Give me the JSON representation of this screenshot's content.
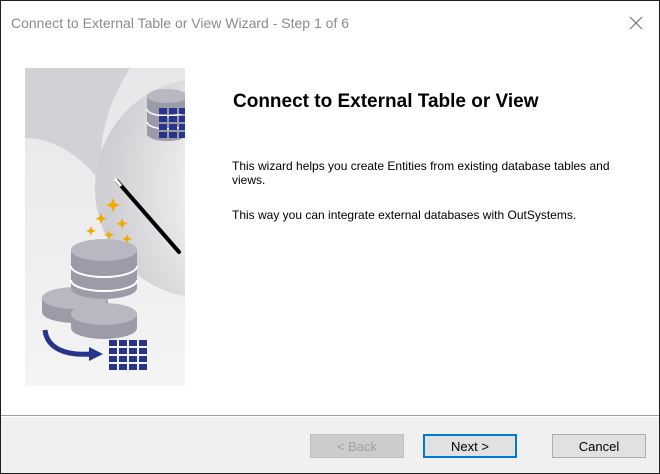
{
  "window": {
    "title": "Connect to External Table or View Wizard - Step 1 of 6",
    "close_icon": "close-icon"
  },
  "main": {
    "heading": "Connect to External Table or View",
    "paragraph1": "This wizard helps you create Entities from existing database tables and views.",
    "paragraph2": "This way you can integrate external databases with OutSystems.",
    "illustration_icons": [
      "database-icon",
      "table-icon",
      "magic-wand-icon",
      "sparkle-icon",
      "arrow-icon"
    ]
  },
  "footer": {
    "back_label": "< Back",
    "next_label": "Next >",
    "cancel_label": "Cancel"
  },
  "colors": {
    "accent": "#0078d7",
    "table_blue": "#27348b",
    "database_gray": "#9c9ba8"
  }
}
